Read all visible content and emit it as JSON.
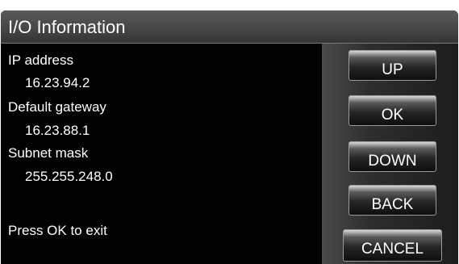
{
  "window": {
    "title": "I/O Information"
  },
  "info": {
    "ip_label": "IP address",
    "ip_value": "16.23.94.2",
    "gateway_label": "Default gateway",
    "gateway_value": "16.23.88.1",
    "subnet_label": "Subnet mask",
    "subnet_value": "255.255.248.0",
    "hint": "Press OK to exit"
  },
  "buttons": {
    "up": "UP",
    "ok": "OK",
    "down": "DOWN",
    "back": "BACK",
    "cancel": "CANCEL"
  },
  "colors": {
    "background": "#000000",
    "text": "#ffffff",
    "title_bar": "#4a4a4a"
  }
}
